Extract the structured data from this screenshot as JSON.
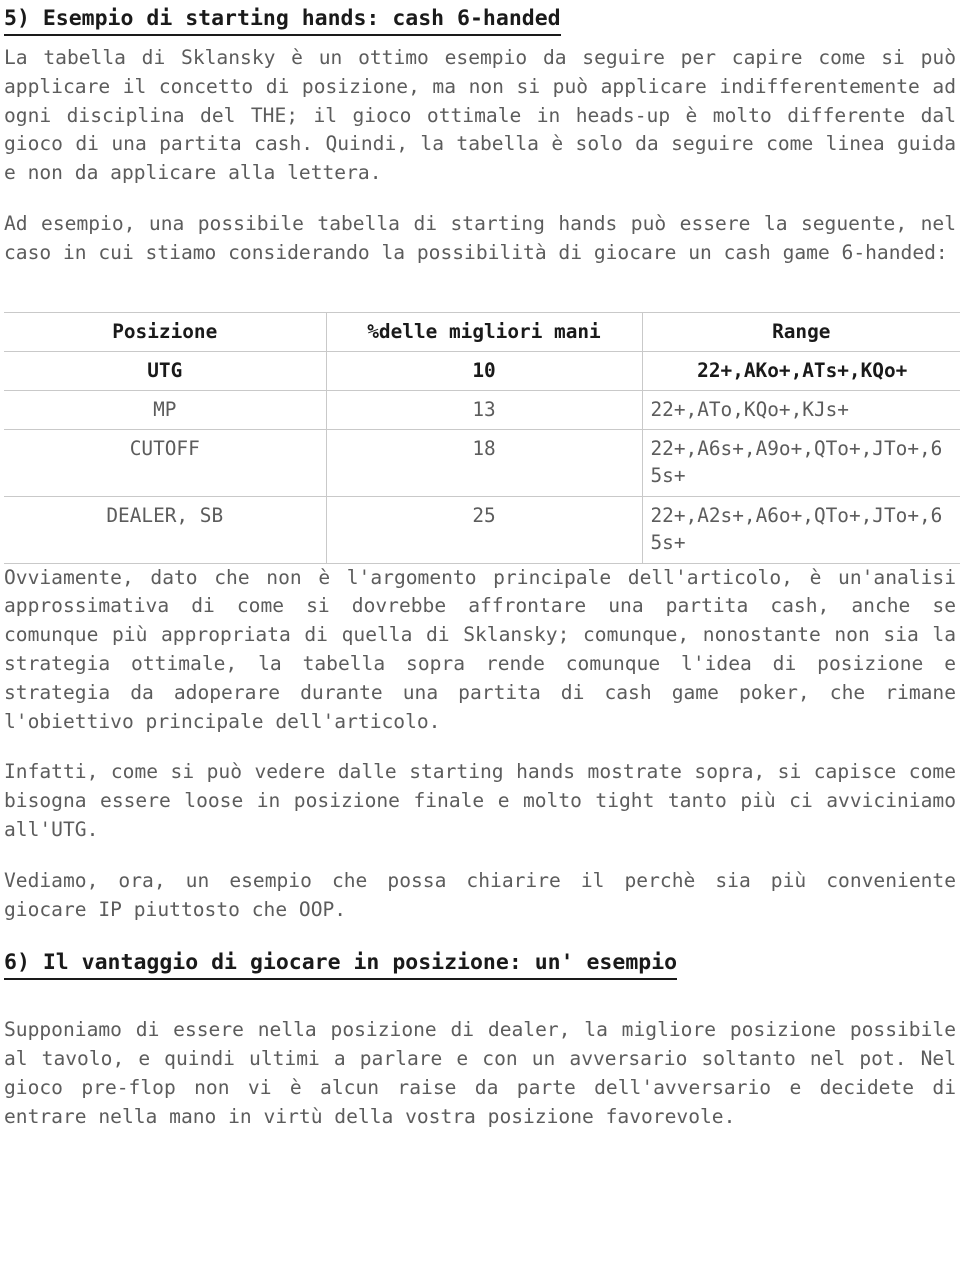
{
  "document": {
    "section5": {
      "heading": "5) Esempio di starting hands: cash 6-handed",
      "paragraph1": "La tabella di Sklansky è un ottimo esempio da seguire per capire come si può applicare il concetto di posizione, ma non si può applicare indifferentemente ad ogni disciplina del THE; il gioco ottimale in heads-up è molto differente dal gioco di una partita cash. Quindi, la tabella è solo da seguire come linea guida e non da applicare alla lettera.",
      "paragraph2": "Ad esempio, una possibile tabella di starting hands può essere la seguente, nel caso in cui stiamo considerando la possibilità di giocare un cash game 6-handed:",
      "paragraph3": "Ovviamente, dato che non è l'argomento principale dell'articolo, è un'analisi approssimativa di come si dovrebbe affrontare una partita cash, anche se comunque più appropriata di quella di Sklansky; comunque, nonostante non sia la strategia ottimale, la tabella sopra rende comunque l'idea di posizione e strategia da adoperare durante una partita di cash game poker, che rimane l'obiettivo principale dell'articolo.",
      "paragraph4": "Infatti, come si può vedere dalle starting hands mostrate sopra, si capisce come bisogna essere loose in posizione finale e molto tight tanto più ci avviciniamo all'UTG.",
      "paragraph5": "Vediamo, ora,  un esempio che possa chiarire il perchè sia più conveniente giocare IP piuttosto che OOP."
    },
    "starting_hands_table": {
      "headers": [
        "Posizione",
        "%delle migliori mani",
        "Range"
      ],
      "rows": [
        {
          "position": "UTG",
          "percent": "10",
          "range": "22+,AKo+,ATs+,KQo+",
          "highlight": true,
          "tall": false
        },
        {
          "position": "MP",
          "percent": "13",
          "range": "22+,ATo,KQo+,KJs+",
          "highlight": false,
          "tall": false
        },
        {
          "position": "CUTOFF",
          "percent": "18",
          "range": "22+,A6s+,A9o+,QTo+,JTo+,65s+",
          "highlight": false,
          "tall": true
        },
        {
          "position": "DEALER, SB",
          "percent": "25",
          "range": "22+,A2s+,A6o+,QTo+,JTo+,65s+",
          "highlight": false,
          "tall": true
        }
      ]
    },
    "section6": {
      "heading": "6) Il vantaggio di giocare in posizione: un' esempio",
      "paragraph1": "Supponiamo di essere nella posizione di dealer, la migliore posizione possibile al tavolo, e quindi ultimi a parlare e con un avversario soltanto nel pot. Nel gioco pre-flop non vi è alcun raise da parte dell'avversario e decidete di entrare nella mano in virtù della vostra posizione favorevole."
    }
  }
}
